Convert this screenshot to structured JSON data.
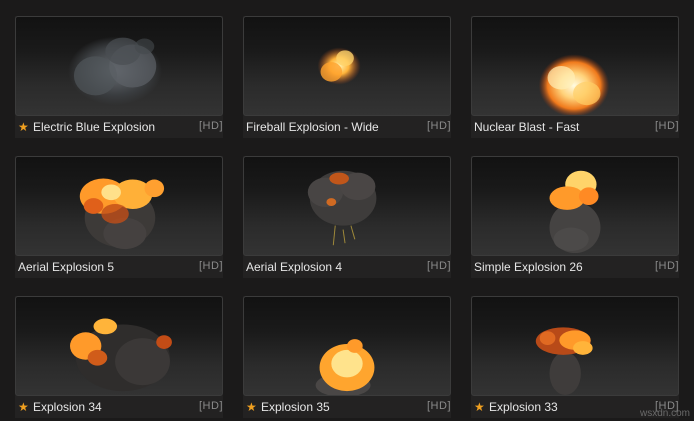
{
  "gallery": {
    "items": [
      {
        "title": "Electric Blue Explosion",
        "badge": "[HD]",
        "favorite": true,
        "preview": "smoke-cloud-icon"
      },
      {
        "title": "Fireball Explosion - Wide",
        "badge": "[HD]",
        "favorite": false,
        "preview": "small-fireball-icon"
      },
      {
        "title": "Nuclear Blast - Fast",
        "badge": "[HD]",
        "favorite": false,
        "preview": "bright-blast-icon"
      },
      {
        "title": "Aerial Explosion 5",
        "badge": "[HD]",
        "favorite": false,
        "preview": "fire-smoke-icon"
      },
      {
        "title": "Aerial Explosion 4",
        "badge": "[HD]",
        "favorite": false,
        "preview": "dark-smoke-icon"
      },
      {
        "title": "Simple Explosion 26",
        "badge": "[HD]",
        "favorite": false,
        "preview": "fire-smoke-icon"
      },
      {
        "title": "Explosion 34",
        "badge": "[HD]",
        "favorite": true,
        "preview": "fire-smoke-icon"
      },
      {
        "title": "Explosion 35",
        "badge": "[HD]",
        "favorite": true,
        "preview": "ground-fireball-icon"
      },
      {
        "title": "Explosion 33",
        "badge": "[HD]",
        "favorite": true,
        "preview": "fire-smoke-icon"
      }
    ]
  },
  "footer": {
    "watermark": "wsxdn.com"
  },
  "colors": {
    "star": "#f0a020",
    "background": "#1b1a1a"
  }
}
